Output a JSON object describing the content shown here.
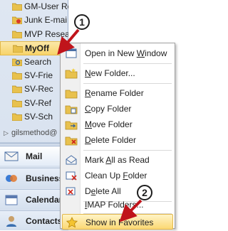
{
  "folders": [
    {
      "label": "GM-User Req"
    },
    {
      "label": "Junk E-mai"
    },
    {
      "label": "MVP Resear"
    },
    {
      "label": "MyOff",
      "selected": true
    },
    {
      "label": "Search"
    },
    {
      "label": "SV-Frie"
    },
    {
      "label": "SV-Rec"
    },
    {
      "label": "SV-Ref"
    },
    {
      "label": "SV-Sch"
    }
  ],
  "mailbox_label": "gilsmethod@",
  "nav_buttons": [
    {
      "label": "Mail",
      "active": true
    },
    {
      "label": "Business"
    },
    {
      "label": "Calendar"
    },
    {
      "label": "Contacts"
    }
  ],
  "menu": {
    "open_new_window": {
      "pre": "Open in New ",
      "acc": "W",
      "post": "indow"
    },
    "new_folder": {
      "pre": "",
      "acc": "N",
      "post": "ew Folder..."
    },
    "rename_folder": {
      "pre": "",
      "acc": "R",
      "post": "ename Folder"
    },
    "copy_folder": {
      "pre": "",
      "acc": "C",
      "post": "opy Folder"
    },
    "move_folder": {
      "pre": "",
      "acc": "M",
      "post": "ove Folder"
    },
    "delete_folder": {
      "pre": "",
      "acc": "D",
      "post": "elete Folder"
    },
    "mark_all_read": {
      "pre": "Mark ",
      "acc": "A",
      "post": "ll as Read"
    },
    "clean_up": {
      "pre": "Clean Up ",
      "acc": "F",
      "post": "older"
    },
    "delete_all": {
      "pre": "D",
      "acc": "e",
      "post": "lete All"
    },
    "imap_folders": {
      "pre": "",
      "acc": "I",
      "post": "MAP Folders..."
    },
    "show_favorites": {
      "pre": "Show in Favorites",
      "acc": "",
      "post": ""
    }
  },
  "steps": {
    "one": "1",
    "two": "2"
  },
  "colors": {
    "accent_red": "#c0141b",
    "highlight": "#fbd874",
    "folder_yellow": "#e8c14d"
  }
}
